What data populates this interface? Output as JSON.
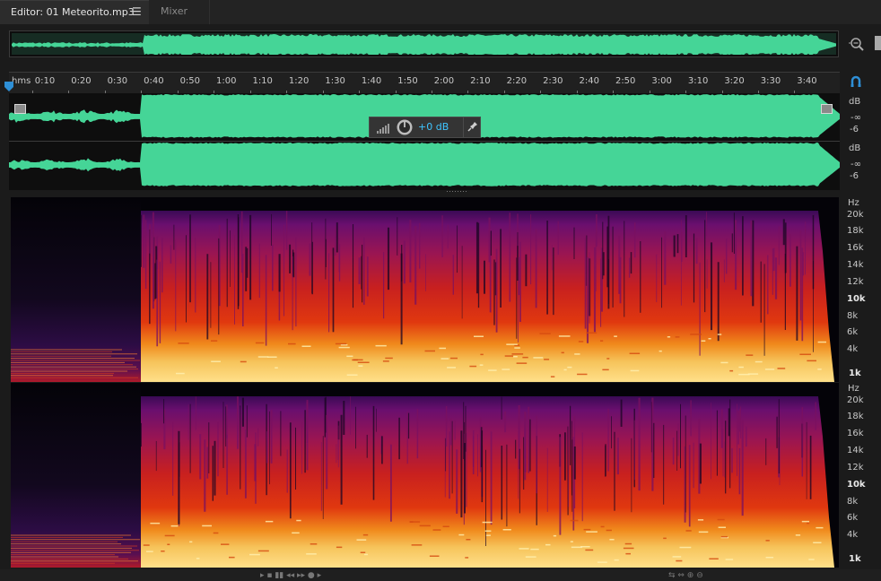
{
  "tabs": {
    "editor_label": "Editor: 01 Meteorito.mp3",
    "mixer_label": "Mixer"
  },
  "ruler": {
    "unit": "hms",
    "ticks": [
      "0:10",
      "0:20",
      "0:30",
      "0:40",
      "0:50",
      "1:00",
      "1:10",
      "1:20",
      "1:30",
      "1:40",
      "1:50",
      "2:00",
      "2:10",
      "2:20",
      "2:30",
      "2:40",
      "2:50",
      "3:00",
      "3:10",
      "3:20",
      "3:30",
      "3:40"
    ]
  },
  "waveform": {
    "channel_scale": {
      "unit": "dB",
      "labels": [
        "-∞",
        "-6"
      ]
    },
    "fade_in": "fade-in-handle",
    "fade_out": "fade-out-handle"
  },
  "hud": {
    "volume": "+0 dB",
    "icons": [
      "level-bars-icon",
      "volume-knob-icon",
      "pin-icon"
    ]
  },
  "spectral": {
    "unit": "Hz",
    "labels": [
      "20k",
      "18k",
      "16k",
      "14k",
      "12k",
      "10k",
      "8k",
      "6k",
      "4k",
      "1k"
    ]
  },
  "icons": [
    "zoom-icon",
    "panel-icon",
    "playhead-icon",
    "snap-icon"
  ],
  "colors": {
    "waveform": "#45d597",
    "hud_value": "#3fc5ff",
    "playhead": "#2e8fd6"
  }
}
